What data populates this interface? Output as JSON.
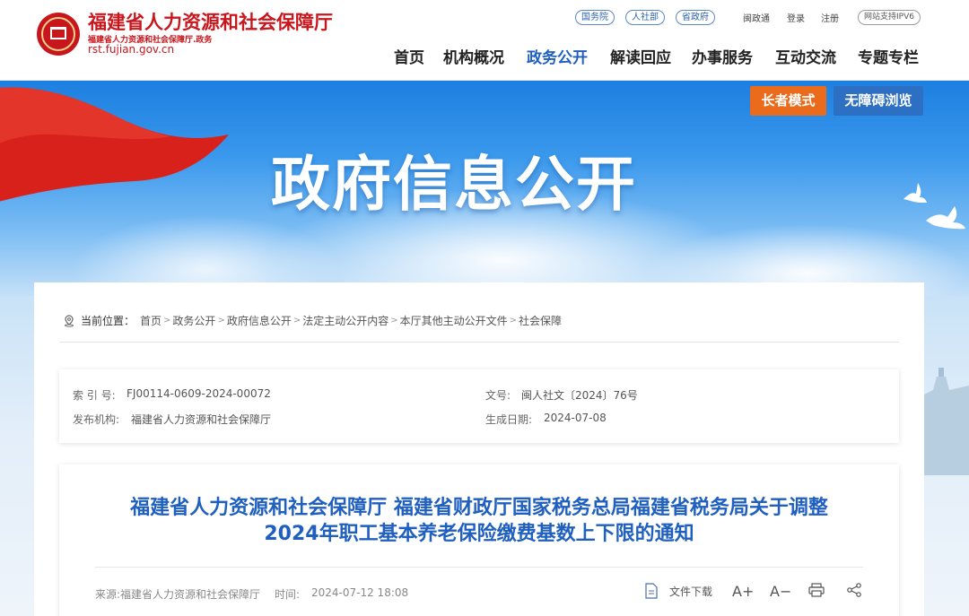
{
  "header": {
    "brand_name": "福建省人力资源和社会保障厅",
    "brand_sub": "福建省人力资源和社会保障厅.政务",
    "brand_domain": "rst.fujian.gov.cn",
    "pills": [
      "国务院",
      "人社部",
      "省政府"
    ],
    "top_links": [
      "闽政通",
      "登录",
      "注册"
    ],
    "ipv6": "网站支持IPV6",
    "nav": [
      "首页",
      "机构概况",
      "政务公开",
      "解读回应",
      "办事服务",
      "互动交流",
      "专题专栏"
    ],
    "nav_active": "政务公开"
  },
  "banner": {
    "title": "政府信息公开",
    "elder_mode": "长者模式",
    "accessible": "无障碍浏览",
    "colors": {
      "elder": "#ea6b1c",
      "accessible": "#2d6fc2",
      "flag": "#d9211c"
    }
  },
  "breadcrumb": {
    "current_label": "当前位置：",
    "items": [
      "首页",
      "政务公开",
      "政府信息公开",
      "法定主动公开内容",
      "本厅其他主动公开文件",
      "社会保障"
    ]
  },
  "info": {
    "index_label": "索 引 号:",
    "index_value": "FJ00114-0609-2024-00072",
    "docno_label": "文号:",
    "docno_value": "闽人社文〔2024〕76号",
    "org_label": "发布机构:",
    "org_value": "福建省人力资源和社会保障厅",
    "date_label": "生成日期:",
    "date_value": "2024-07-08"
  },
  "article": {
    "title_line1": "福建省人力资源和社会保障厅 福建省财政厅国家税务总局福建省税务局关于调整",
    "title_line2": "2024年职工基本养老保险缴费基数上下限的通知",
    "source": "来源:福建省人力资源和社会保障厅",
    "time_label": "时间:",
    "time_value": "2024-07-12 18:08",
    "download": "文件下载",
    "font_up": "A+",
    "font_down": "A−"
  }
}
